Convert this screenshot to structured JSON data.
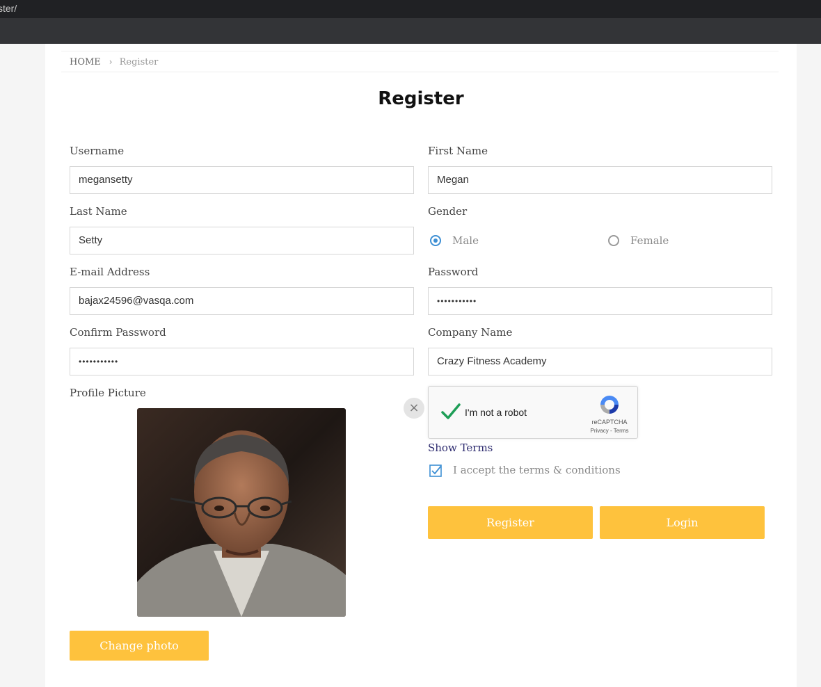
{
  "browser": {
    "url_fragment": "ster/"
  },
  "breadcrumb": {
    "home": "HOME",
    "separator": "›",
    "current": "Register"
  },
  "page": {
    "title": "Register"
  },
  "form": {
    "username": {
      "label": "Username",
      "value": "megansetty"
    },
    "first_name": {
      "label": "First Name",
      "value": "Megan"
    },
    "last_name": {
      "label": "Last Name",
      "value": "Setty"
    },
    "gender": {
      "label": "Gender",
      "options": [
        {
          "label": "Male",
          "checked": true
        },
        {
          "label": "Female",
          "checked": false
        }
      ]
    },
    "email": {
      "label": "E-mail Address",
      "value": "bajax24596@vasqa.com"
    },
    "password": {
      "label": "Password",
      "value": "•••••••••••"
    },
    "confirm_password": {
      "label": "Confirm Password",
      "value": "•••••••••••"
    },
    "company_name": {
      "label": "Company Name",
      "value": "Crazy Fitness Academy"
    },
    "profile_picture": {
      "label": "Profile Picture",
      "remove_symbol": "×",
      "change_label": "Change photo"
    }
  },
  "captcha": {
    "label": "I'm not a robot",
    "brand": "reCAPTCHA",
    "links": "Privacy - Terms"
  },
  "terms": {
    "show_label": "Show Terms",
    "accept_label": "I accept the terms & conditions",
    "accepted": true
  },
  "actions": {
    "register_label": "Register",
    "login_label": "Login"
  },
  "colors": {
    "accent": "#fec23d",
    "radio": "#3d8fd4",
    "link": "#2c2a6e",
    "topbar": "#202124",
    "navbar": "#333437"
  }
}
